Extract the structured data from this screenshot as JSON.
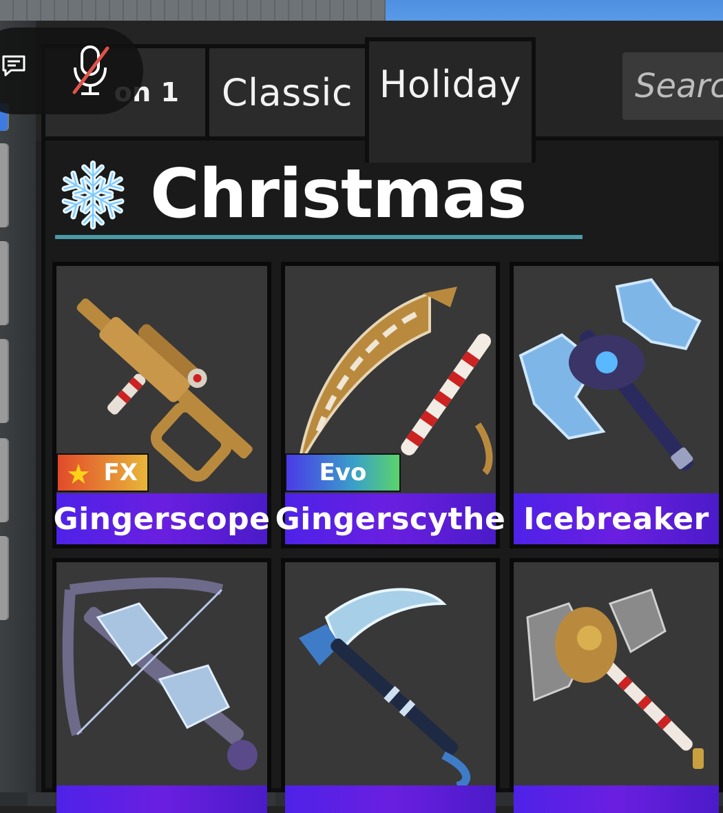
{
  "tabs": [
    {
      "label": "Season 1",
      "visible_label": "on 1"
    },
    {
      "label": "Classic"
    },
    {
      "label": "Holiday",
      "active": true
    }
  ],
  "search": {
    "placeholder": "Searc"
  },
  "section": {
    "title": "Christmas",
    "icon": "snowflake-icon"
  },
  "items": [
    {
      "name": "Gingerscope",
      "badge": "FX",
      "badge_icon": "star-icon"
    },
    {
      "name": "Gingerscythe",
      "badge": "Evo"
    },
    {
      "name": "Icebreaker",
      "badge": ""
    },
    {
      "name": "",
      "badge": ""
    },
    {
      "name": "",
      "badge": ""
    },
    {
      "name": "",
      "badge": ""
    }
  ],
  "colors": {
    "name_bar": "#5a22e6",
    "underline": "#4a9aa8",
    "panel": "#202020",
    "fx_badge": "#e8a03a",
    "evo_badge": "#4a8ad8"
  },
  "overlay": {
    "chat_icon": "chat-icon",
    "mic_icon": "mic-muted-icon"
  }
}
